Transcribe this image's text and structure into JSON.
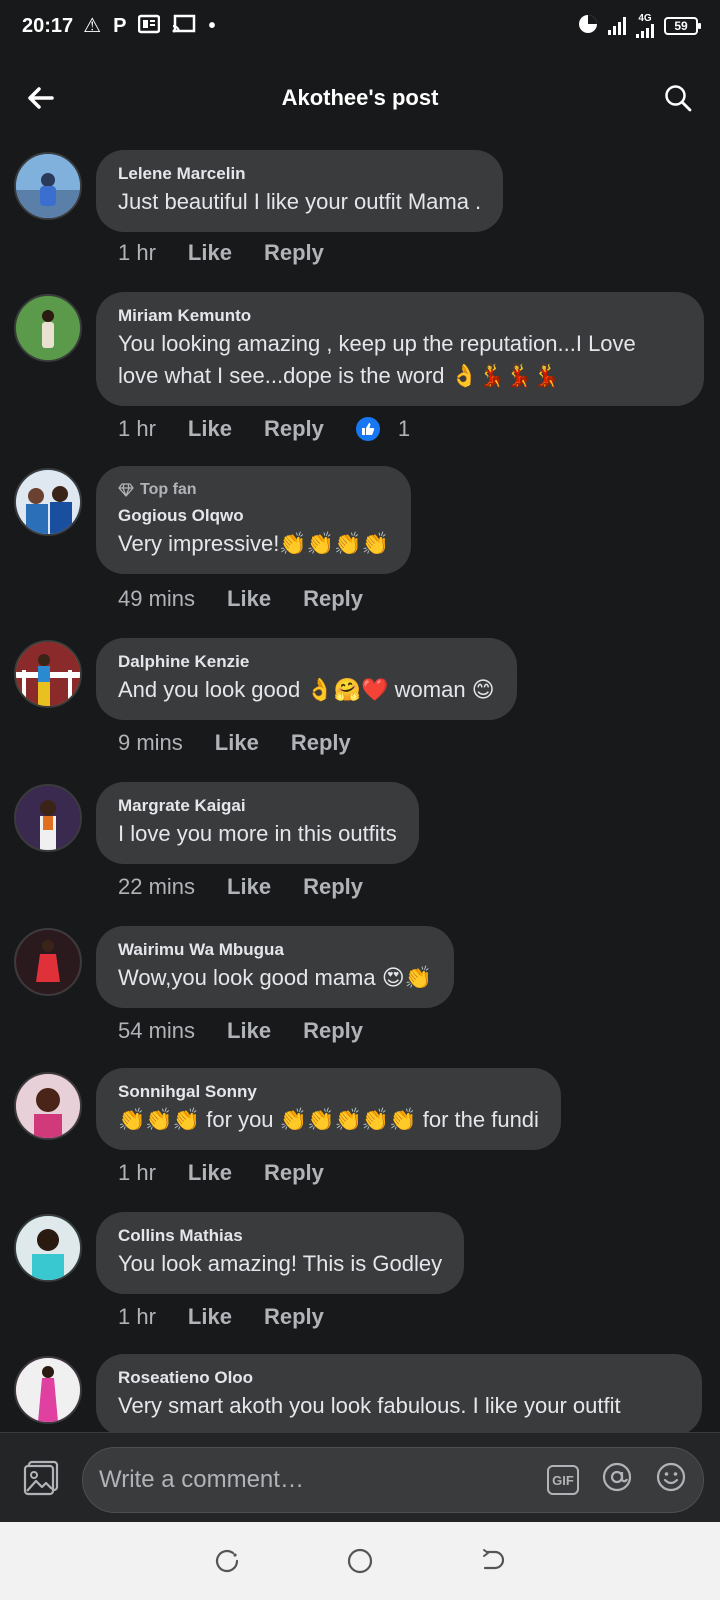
{
  "status_bar": {
    "time": "20:17",
    "network": "4G",
    "battery": "59"
  },
  "header": {
    "title": "Akothee's post"
  },
  "comments": [
    {
      "author": "Lelene Marcelin",
      "text": "Just beautiful I like your outfit Mama .",
      "time": "1 hr",
      "like": "Like",
      "reply": "Reply",
      "avatar_color": "#5a8fc7"
    },
    {
      "author": "Miriam Kemunto",
      "text": "You looking amazing , keep up the reputation...I Love love what I see...dope is the word 👌💃💃💃",
      "time": "1 hr",
      "like": "Like",
      "reply": "Reply",
      "reactions": "1",
      "avatar_color": "#3e7a3a"
    },
    {
      "badge": "Top fan",
      "author": "Gogious Olqwo",
      "text": "Very impressive!👏👏👏👏",
      "time": "49 mins",
      "like": "Like",
      "reply": "Reply",
      "avatar_color": "#2b6fb8"
    },
    {
      "author": "Dalphine Kenzie",
      "text": "And you look good 👌🤗❤️ woman 😊",
      "time": "9 mins",
      "like": "Like",
      "reply": "Reply",
      "avatar_color": "#c79a2a"
    },
    {
      "author": "Margrate Kaigai",
      "text": "I love you more in this outfits",
      "time": "22 mins",
      "like": "Like",
      "reply": "Reply",
      "avatar_color": "#4a2f5a"
    },
    {
      "author": "Wairimu Wa Mbugua",
      "text": "Wow,you look good mama 😍👏",
      "time": "54 mins",
      "like": "Like",
      "reply": "Reply",
      "avatar_color": "#a02a34"
    },
    {
      "author": "Sonnihgal Sonny",
      "text": "👏👏👏 for you 👏👏👏👏👏 for the fundi",
      "time": "1 hr",
      "like": "Like",
      "reply": "Reply",
      "avatar_color": "#c04a6a"
    },
    {
      "author": "Collins Mathias",
      "text": "You look amazing! This is Godley",
      "time": "1 hr",
      "like": "Like",
      "reply": "Reply",
      "avatar_color": "#3ab0b8"
    },
    {
      "author": "Roseatieno Oloo",
      "text": "Very smart akoth you look fabulous. I like your outfit",
      "avatar_color": "#d43fa0"
    }
  ],
  "composer": {
    "placeholder": "Write a comment…",
    "gif_label": "GIF"
  },
  "icons": {
    "back": "arrow-left-icon",
    "search": "search-icon",
    "photo": "photo-icon",
    "mention": "at-icon",
    "emoji": "emoji-icon"
  }
}
